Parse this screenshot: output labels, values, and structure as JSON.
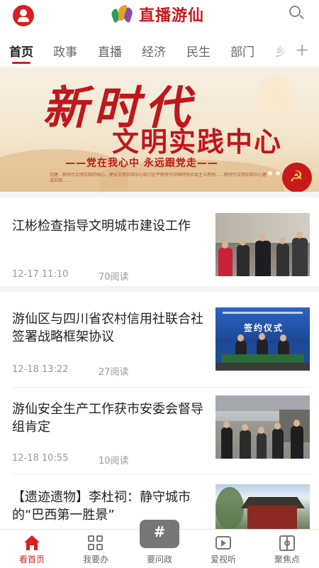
{
  "header": {
    "brand": "直播游仙",
    "avatar_icon": "user-avatar-icon",
    "search_icon": "search-icon",
    "accent": "#d81e1e"
  },
  "tabs": [
    {
      "label": "首页",
      "active": true
    },
    {
      "label": "政事",
      "active": false
    },
    {
      "label": "直播",
      "active": false
    },
    {
      "label": "经济",
      "active": false
    },
    {
      "label": "民生",
      "active": false
    },
    {
      "label": "部门",
      "active": false
    },
    {
      "label": "乡",
      "active": false
    }
  ],
  "banner": {
    "headline_big": "新时代",
    "headline_mid": "文明实践中心",
    "slogan": "——党在我心中 永远跟党走——",
    "fine_print": "党建、新时代文明实践的核心，建设文明实践中心和习近平新时代中国特色社会主义思想……新时代文明实践中心建设实践……"
  },
  "articles": [
    {
      "title": "江彬检查指导文明城市建设工作",
      "time": "12-17 11:10",
      "reads": "70阅读"
    },
    {
      "title": "游仙区与四川省农村信用社联合社签署战略框架协议",
      "time": "12-18 13:22",
      "reads": "27阅读",
      "image_text": "签约仪式"
    },
    {
      "title": "游仙安全生产工作获市安委会督导组肯定",
      "time": "12-18 10:55",
      "reads": "10阅读"
    },
    {
      "title": "【遗迹遗物】李杜祠：静守城市的“巴西第一胜景”"
    }
  ],
  "bottom_nav": [
    {
      "label": "看首页",
      "icon": "home-icon",
      "active": true
    },
    {
      "label": "我要办",
      "icon": "grid-icon",
      "active": false
    },
    {
      "label": "要问政",
      "icon": "hashtag-icon",
      "active": false
    },
    {
      "label": "爱视听",
      "icon": "play-icon",
      "active": false
    },
    {
      "label": "聚焦点",
      "icon": "focus-icon",
      "active": false
    }
  ]
}
